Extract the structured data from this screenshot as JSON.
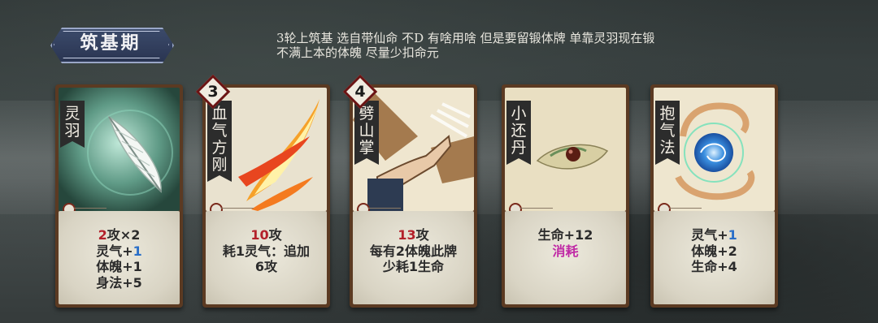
{
  "stage": {
    "label": "筑基期"
  },
  "hint": {
    "line1": "3轮上筑基  选自带仙命  不D  有啥用啥  但是要留锻体牌  单靠灵羽现在锻",
    "line2": "不满上本的体魄  尽量少扣命元"
  },
  "cards": [
    {
      "name": "灵羽",
      "cost": "",
      "art": "feather",
      "lines": [
        {
          "parts": [
            {
              "t": "2",
              "c": "red"
            },
            {
              "t": "攻×2",
              "c": ""
            }
          ]
        },
        {
          "parts": [
            {
              "t": "灵气+",
              "c": ""
            },
            {
              "t": "1",
              "c": "blue"
            }
          ]
        },
        {
          "parts": [
            {
              "t": "体魄+1",
              "c": ""
            }
          ]
        },
        {
          "parts": [
            {
              "t": "身法+5",
              "c": ""
            }
          ]
        }
      ]
    },
    {
      "name": "血气方刚",
      "cost": "3",
      "art": "flame-slash",
      "lines": [
        {
          "parts": [
            {
              "t": "10",
              "c": "red"
            },
            {
              "t": "攻",
              "c": ""
            }
          ]
        },
        {
          "parts": [
            {
              "t": "耗1灵气：追加",
              "c": ""
            }
          ]
        },
        {
          "parts": [
            {
              "t": "6攻",
              "c": ""
            }
          ]
        }
      ]
    },
    {
      "name": "劈山掌",
      "cost": "4",
      "art": "palm-strike",
      "lines": [
        {
          "parts": [
            {
              "t": "13",
              "c": "red"
            },
            {
              "t": "攻",
              "c": ""
            }
          ]
        },
        {
          "parts": [
            {
              "t": "每有2体魄此牌",
              "c": ""
            }
          ]
        },
        {
          "parts": [
            {
              "t": "少耗1生命",
              "c": ""
            }
          ]
        }
      ]
    },
    {
      "name": "小还丹",
      "cost": "",
      "art": "pill",
      "lines": [
        {
          "parts": [
            {
              "t": "生命+12",
              "c": ""
            }
          ]
        },
        {
          "parts": [
            {
              "t": "消耗",
              "c": "pink"
            }
          ]
        }
      ]
    },
    {
      "name": "抱气法",
      "cost": "",
      "art": "qi-orb",
      "lines": [
        {
          "parts": [
            {
              "t": "灵气+",
              "c": ""
            },
            {
              "t": "1",
              "c": "blue"
            }
          ]
        },
        {
          "parts": [
            {
              "t": "体魄+2",
              "c": ""
            }
          ]
        },
        {
          "parts": [
            {
              "t": "生命+4",
              "c": ""
            }
          ]
        }
      ]
    }
  ],
  "colors": {
    "damage": "#b3202a",
    "qi": "#2a6fc8",
    "exhaust": "#c02aa5",
    "card_frame": "#5b3a22"
  }
}
